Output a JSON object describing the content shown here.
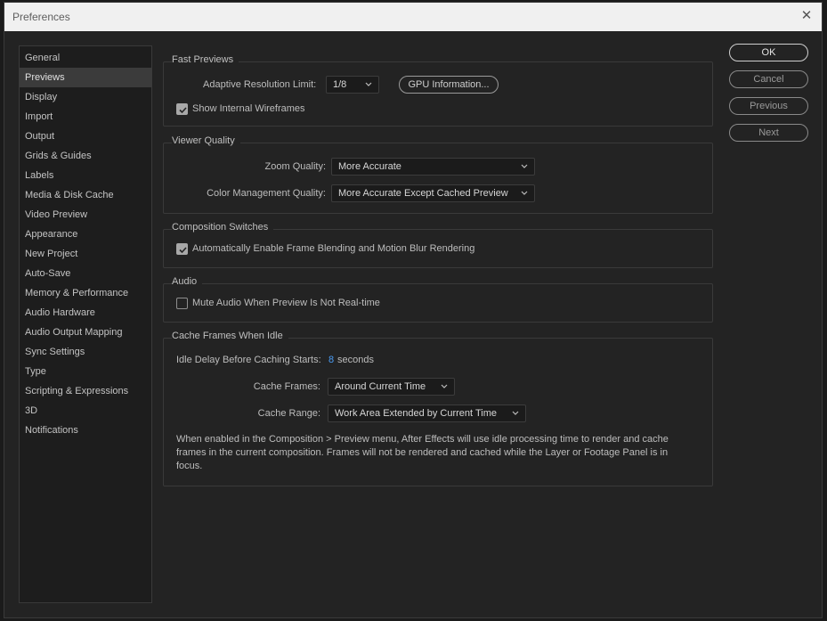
{
  "window": {
    "title": "Preferences",
    "close_symbol": "✕"
  },
  "sidebar": {
    "items": [
      {
        "label": "General"
      },
      {
        "label": "Previews"
      },
      {
        "label": "Display"
      },
      {
        "label": "Import"
      },
      {
        "label": "Output"
      },
      {
        "label": "Grids & Guides"
      },
      {
        "label": "Labels"
      },
      {
        "label": "Media & Disk Cache"
      },
      {
        "label": "Video Preview"
      },
      {
        "label": "Appearance"
      },
      {
        "label": "New Project"
      },
      {
        "label": "Auto-Save"
      },
      {
        "label": "Memory & Performance"
      },
      {
        "label": "Audio Hardware"
      },
      {
        "label": "Audio Output Mapping"
      },
      {
        "label": "Sync Settings"
      },
      {
        "label": "Type"
      },
      {
        "label": "Scripting & Expressions"
      },
      {
        "label": "3D"
      },
      {
        "label": "Notifications"
      }
    ],
    "selected": "Previews"
  },
  "fast_previews": {
    "title": "Fast Previews",
    "adaptive_label": "Adaptive Resolution Limit:",
    "adaptive_value": "1/8",
    "gpu_button": "GPU Information...",
    "wireframes_label": "Show Internal Wireframes",
    "wireframes_checked": true
  },
  "viewer_quality": {
    "title": "Viewer Quality",
    "zoom_label": "Zoom Quality:",
    "zoom_value": "More Accurate",
    "color_label": "Color Management Quality:",
    "color_value": "More Accurate Except Cached Preview"
  },
  "composition_switches": {
    "title": "Composition Switches",
    "blend_label": "Automatically Enable Frame Blending and Motion Blur Rendering",
    "blend_checked": true
  },
  "audio": {
    "title": "Audio",
    "mute_label": "Mute Audio When Preview Is Not Real-time",
    "mute_checked": false
  },
  "cache_frames": {
    "title": "Cache Frames When Idle",
    "idle_label": "Idle Delay Before Caching Starts:",
    "idle_value": "8",
    "idle_unit": "seconds",
    "frames_label": "Cache Frames:",
    "frames_value": "Around Current Time",
    "range_label": "Cache Range:",
    "range_value": "Work Area Extended by Current Time",
    "description": "When enabled in the Composition > Preview menu, After Effects will use idle processing time to render and cache frames in the current composition. Frames will not be rendered and cached while the Layer or Footage Panel is in focus."
  },
  "buttons": {
    "ok": "OK",
    "cancel": "Cancel",
    "previous": "Previous",
    "next": "Next"
  },
  "colors": {
    "accent_value": "#4a9cf5",
    "selected_item_bg": "#3b3b3b",
    "dialog_bg": "#232323"
  }
}
